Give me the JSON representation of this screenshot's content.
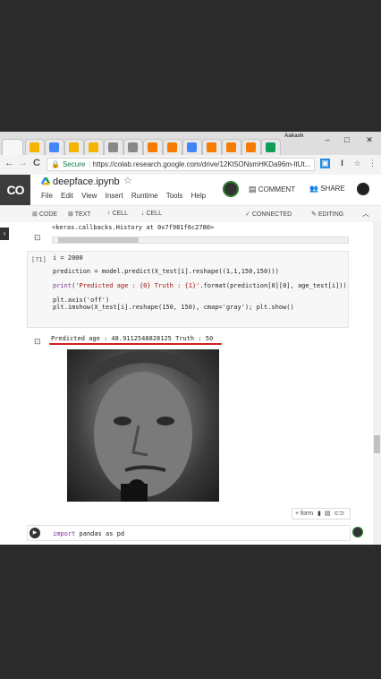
{
  "browser": {
    "profile_name": "Aakash",
    "tab_favicon_colors": [
      "#f4b400",
      "#4285f4",
      "#f4b400",
      "#f4b400",
      "#888888",
      "#888888",
      "#f57c00",
      "#f57c00",
      "#4285f4",
      "#f57c00",
      "#f57c00",
      "#f57c00",
      "#0f9d58"
    ],
    "window_controls": {
      "minimize": "–",
      "maximize": "□",
      "close": "✕"
    },
    "nav": {
      "back": "←",
      "forward": "→",
      "reload": "C"
    },
    "secure_label": "Secure",
    "url": "https://colab.research.google.com/drive/12Kt5ONsmHKDa96m-ltUt..."
  },
  "colab": {
    "logo": "CO",
    "notebook_title": "deepface.ipynb",
    "menu": [
      "File",
      "Edit",
      "View",
      "Insert",
      "Runtime",
      "Tools",
      "Help"
    ],
    "comment_label": "COMMENT",
    "share_label": "SHARE"
  },
  "toolbar": {
    "code": "CODE",
    "text": "TEXT",
    "cell_up": "CELL",
    "cell_down": "CELL",
    "status": "CONNECTED",
    "editing": "EDITING"
  },
  "cells": {
    "prev_output": "<keras.callbacks.History at 0x7f981f6c2780>",
    "exec_count": "[71]",
    "code_lines": {
      "l1": "i = 2000",
      "l2": "prediction = model.predict(X_test[i].reshape((1,1,150,150)))",
      "l3_fn": "print",
      "l3_str": "'Predicted age : {0} Truth : {1}'",
      "l3_rest": ".format(prediction[0][0], age_test[i]))",
      "l4": "plt.axis('off')",
      "l5": "plt.imshow(X_test[i].reshape(150, 150), cmap='gray'); plt.show()"
    },
    "output_text": "Predicted age : 48.91125488281​25 Truth : 50",
    "form_label": "+ form",
    "next_cell_code_kw": "import",
    "next_cell_code_rest": " pandas as pd"
  }
}
